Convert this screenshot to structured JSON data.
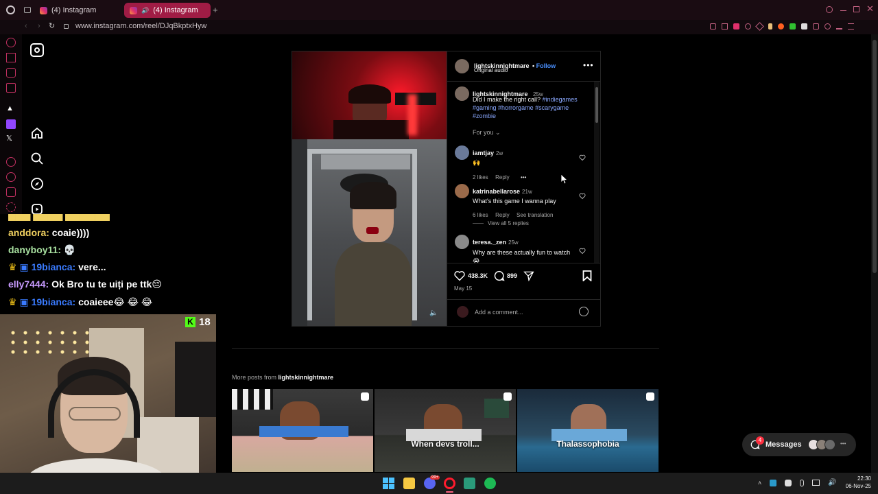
{
  "browser": {
    "tabs": [
      {
        "label": "(4) Instagram"
      },
      {
        "label": "(4) Instagram"
      }
    ],
    "url": "www.instagram.com/reel/DJqBkptxHyw"
  },
  "post": {
    "author": "lightskinnightmare",
    "follow": "Follow",
    "audio": "Original audio",
    "caption_time": "25w",
    "caption_text": "Did I make the right call?",
    "caption_tags": [
      "#indiegames",
      "#gaming",
      "#horrorgame",
      "#scarygame",
      "#zombie"
    ],
    "sort": "For you",
    "comments": [
      {
        "user": "iamtjay",
        "time": "2w",
        "text": "🙌",
        "likes": "2 likes",
        "reply": "Reply"
      },
      {
        "user": "katrinabellarose",
        "time": "21w",
        "text": "What's this game I wanna play",
        "likes": "6 likes",
        "reply": "Reply",
        "translate": "See translation",
        "replies": "View all 5 replies"
      },
      {
        "user": "teresa._zen",
        "time": "25w",
        "text": "Why are these actually fun to watch 😭"
      }
    ],
    "like_count": "438.3K",
    "comment_count": "899",
    "date": "May 15",
    "add_comment_placeholder": "Add a comment..."
  },
  "more_posts": {
    "prefix": "More posts from",
    "author": "lightskinnightmare",
    "items": [
      {
        "label": ""
      },
      {
        "label": "When devs troll..."
      },
      {
        "label": "Thalassophobia"
      }
    ]
  },
  "stream": {
    "chat": [
      {
        "user": "anddora:",
        "text": "coaie))))",
        "color": "#f0d060"
      },
      {
        "user": "danyboy11:",
        "text": "💀",
        "color": "#a8e0a0"
      },
      {
        "user": "19bianca:",
        "text": "vere...",
        "color": "#3a7bff"
      },
      {
        "user": "elly7444:",
        "text": "Ok Bro tu te uiți pe ttk😔",
        "color": "#c89bff"
      },
      {
        "user": "19bianca:",
        "text": "coaieee😂 😂 😂",
        "color": "#3a7bff"
      }
    ],
    "viewer_count": "18"
  },
  "messages": {
    "label": "Messages",
    "badge": "4"
  },
  "taskbar": {
    "time": "22:30",
    "date": "06-Nov-25",
    "spotify_badge": "99+"
  },
  "colors": {
    "accent": "#a01c45",
    "link": "#8aa8ff",
    "follow": "#4a90ff",
    "kick": "#53fc18"
  }
}
